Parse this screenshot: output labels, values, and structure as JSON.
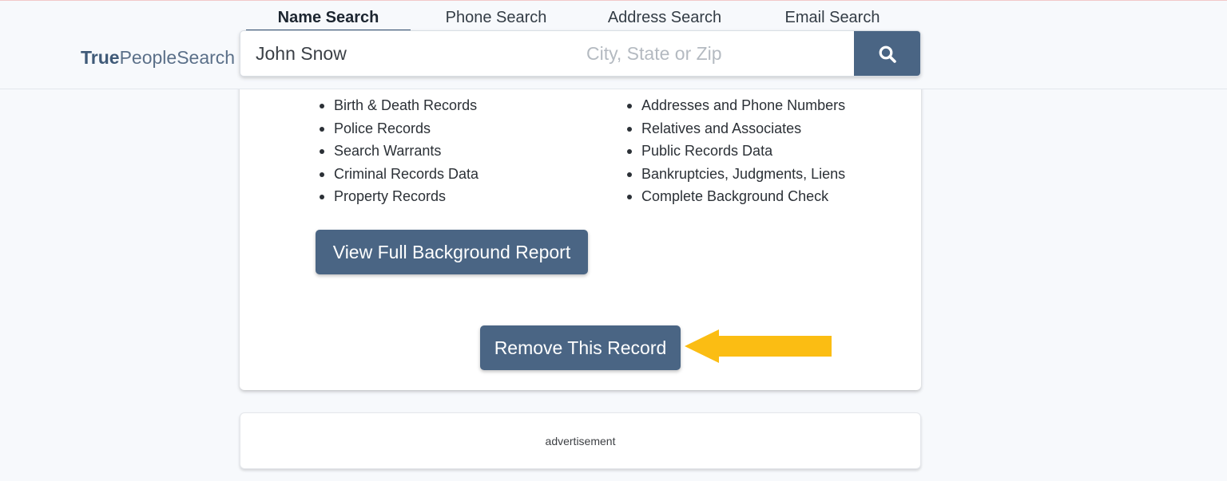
{
  "header": {
    "logo_bold": "True",
    "logo_rest": "PeopleSearch",
    "tabs": [
      {
        "label": "Name Search"
      },
      {
        "label": "Phone Search"
      },
      {
        "label": "Address Search"
      },
      {
        "label": "Email Search"
      }
    ],
    "active_tab": "Name Search",
    "search": {
      "name_value": "John Snow",
      "location_placeholder": "City, State or Zip",
      "button_icon": "search-icon"
    }
  },
  "card": {
    "left_list": [
      "Birth & Death Records",
      "Police Records",
      "Search Warrants",
      "Criminal Records Data",
      "Property Records"
    ],
    "right_list": [
      "Addresses and Phone Numbers",
      "Relatives and Associates",
      "Public Records Data",
      "Bankruptcies, Judgments, Liens",
      "Complete Background Check"
    ],
    "report_button": "View Full Background Report",
    "remove_button": "Remove This Record",
    "annotation": {
      "icon": "arrow-left-icon",
      "color": "#fbbd13"
    }
  },
  "ad": {
    "label": "advertisement"
  },
  "colors": {
    "accent": "#4a6584",
    "logo": "#5b7089",
    "arrow": "#fbbd13",
    "page_bg": "#f7f9fc"
  }
}
